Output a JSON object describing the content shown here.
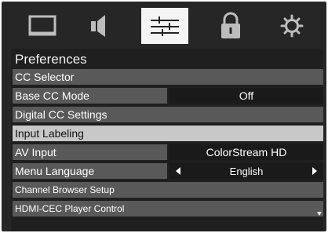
{
  "tabs": [
    {
      "icon": "monitor-icon",
      "selected": false
    },
    {
      "icon": "speaker-icon",
      "selected": false
    },
    {
      "icon": "sliders-icon",
      "selected": true
    },
    {
      "icon": "lock-icon",
      "selected": false
    },
    {
      "icon": "gear-icon",
      "selected": false
    }
  ],
  "menu": {
    "title": "Preferences",
    "items": [
      {
        "label": "CC Selector"
      },
      {
        "label": "Base CC Mode",
        "value": "Off"
      },
      {
        "label": "Digital CC Settings"
      },
      {
        "label": "Input Labeling",
        "highlighted": true
      },
      {
        "label": "AV Input",
        "value": "ColorStream HD"
      },
      {
        "label": "Menu Language",
        "value": "English"
      },
      {
        "label": "Channel Browser Setup"
      },
      {
        "label": "HDMI-CEC Player Control"
      }
    ]
  },
  "colors": {
    "background": "#262626",
    "row": "#595959",
    "highlight": "#c8c8c8",
    "selected_tab": "#f4f4f4"
  }
}
